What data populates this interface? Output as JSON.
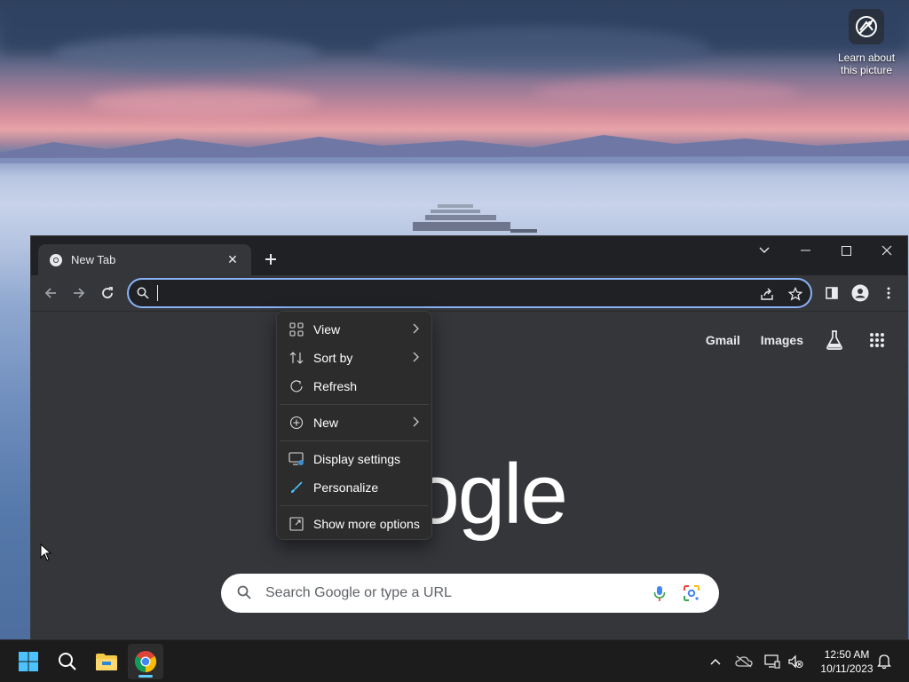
{
  "wallpaper": {
    "learn_widget": {
      "label_line1": "Learn about",
      "label_line2": "this picture",
      "icon": "camera-icon"
    }
  },
  "chrome": {
    "tab": {
      "title": "New Tab",
      "favicon": "chrome-icon"
    },
    "omnibox": {
      "value": "",
      "placeholder": ""
    },
    "toolbar_icons": [
      "back-icon",
      "forward-icon",
      "reload-icon",
      "share-icon",
      "bookmark-star-icon",
      "side-panel-icon",
      "profile-icon",
      "menu-dots-icon"
    ],
    "window_controls": [
      "tab-search-icon",
      "minimize-icon",
      "maximize-icon",
      "close-icon"
    ]
  },
  "newtab": {
    "links": {
      "gmail": "Gmail",
      "images": "Images"
    },
    "logo_text": "oogle",
    "search_placeholder": "Search Google or type a URL"
  },
  "context_menu": {
    "items": [
      {
        "label": "View",
        "icon": "grid-view-icon",
        "submenu": true
      },
      {
        "label": "Sort by",
        "icon": "sort-icon",
        "submenu": true
      },
      {
        "label": "Refresh",
        "icon": "refresh-icon",
        "submenu": false
      },
      {
        "label": "New",
        "icon": "add-circle-icon",
        "submenu": true
      },
      {
        "label": "Display settings",
        "icon": "display-settings-icon",
        "submenu": false
      },
      {
        "label": "Personalize",
        "icon": "brush-icon",
        "submenu": false
      },
      {
        "label": "Show more options",
        "icon": "more-options-icon",
        "submenu": false
      }
    ]
  },
  "taskbar": {
    "apps": [
      "start-icon",
      "search-icon",
      "file-explorer-icon",
      "chrome-icon"
    ],
    "active_app": "chrome-icon",
    "tray": [
      "chevron-up-icon",
      "onedrive-icon",
      "network-icon",
      "volume-mute-icon",
      "notification-bell-icon"
    ],
    "time": "12:50 AM",
    "date": "10/11/2023",
    "accent_color": "#60cdff"
  },
  "colors": {
    "omnibox_focus": "#8ab4f8",
    "chrome_dark": "#202124",
    "chrome_surface": "#35363a",
    "menu_bg": "#2c2c2c"
  }
}
